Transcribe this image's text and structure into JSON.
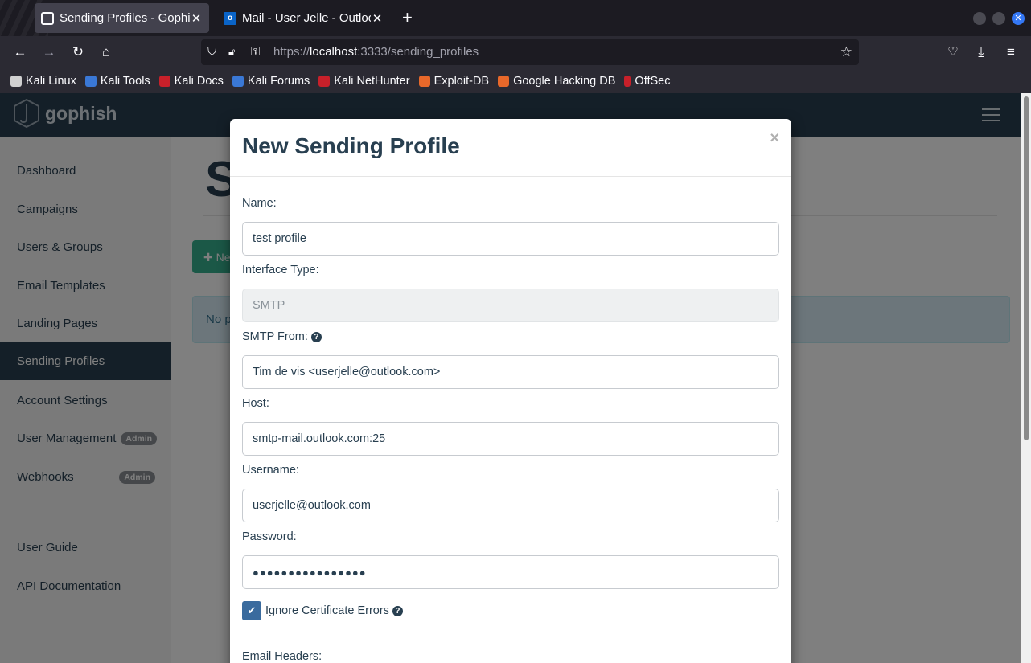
{
  "browser": {
    "tabs": [
      {
        "title": "Sending Profiles - Gophish",
        "favicon": "gophish-icon",
        "active": true
      },
      {
        "title": "Mail - User Jelle - Outlook",
        "favicon": "outlook-icon",
        "active": false
      }
    ],
    "url_scheme": "https://",
    "url_host": "localhost",
    "url_rest": ":3333/sending_profiles",
    "bookmarks": [
      {
        "label": "Kali Linux",
        "color": "#d0d0d0"
      },
      {
        "label": "Kali Tools",
        "color": "#3a78d6"
      },
      {
        "label": "Kali Docs",
        "color": "#c8202a"
      },
      {
        "label": "Kali Forums",
        "color": "#3a78d6"
      },
      {
        "label": "Kali NetHunter",
        "color": "#c8202a"
      },
      {
        "label": "Exploit-DB",
        "color": "#e8682a"
      },
      {
        "label": "Google Hacking DB",
        "color": "#e8682a"
      },
      {
        "label": "OffSec",
        "color": "#c8202a"
      }
    ]
  },
  "app": {
    "brand": "gophish",
    "sidebar": {
      "items": [
        {
          "label": "Dashboard"
        },
        {
          "label": "Campaigns"
        },
        {
          "label": "Users & Groups"
        },
        {
          "label": "Email Templates"
        },
        {
          "label": "Landing Pages"
        },
        {
          "label": "Sending Profiles",
          "active": true
        },
        {
          "label": "Account Settings"
        },
        {
          "label": "User Management",
          "badge": "Admin"
        },
        {
          "label": "Webhooks",
          "badge": "Admin"
        }
      ],
      "footer_items": [
        {
          "label": "User Guide"
        },
        {
          "label": "API Documentation"
        }
      ]
    },
    "background": {
      "heading_fragment": "S",
      "new_button_fragment": "Ne",
      "alert_fragment": "No p"
    }
  },
  "modal": {
    "title": "New Sending Profile",
    "close": "×",
    "fields": {
      "name_label": "Name:",
      "name_value": "test profile",
      "interface_label": "Interface Type:",
      "interface_value": "SMTP",
      "from_label": "SMTP From:",
      "from_value": "Tim de vis <userjelle@outlook.com>",
      "host_label": "Host:",
      "host_value": "smtp-mail.outlook.com:25",
      "username_label": "Username:",
      "username_value": "userjelle@outlook.com",
      "password_label": "Password:",
      "password_value": "●●●●●●●●●●●●●●●●",
      "ignore_cert_label": "Ignore Certificate Errors",
      "ignore_cert_checked": true,
      "headers_label": "Email Headers:"
    }
  },
  "colors": {
    "brand_dark": "#283f50",
    "accent_green": "#37b08e",
    "checkbox": "#3a6b9e"
  }
}
